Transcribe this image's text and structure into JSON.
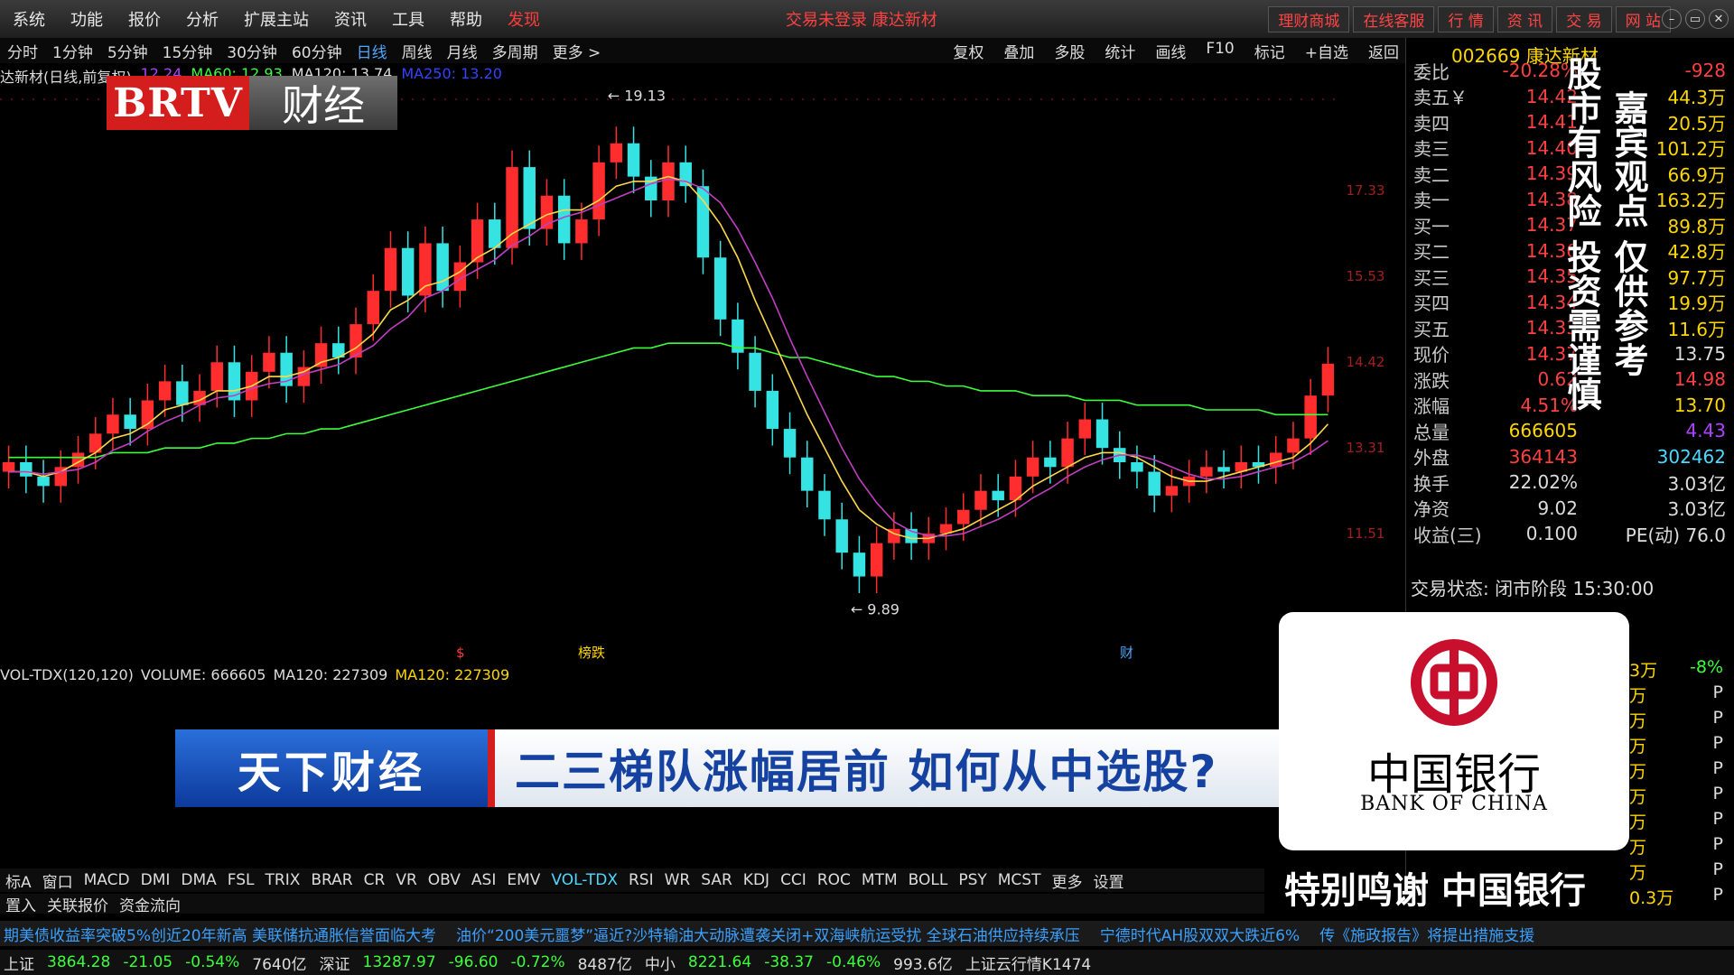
{
  "menu": {
    "items": [
      "系统",
      "功能",
      "报价",
      "分析",
      "扩展主站",
      "资讯",
      "工具",
      "帮助",
      "发现"
    ],
    "center_msg": "交易未登录  康达新材",
    "right_tabs": [
      "理财商城",
      "在线客服",
      "行 情",
      "资 讯",
      "交 易",
      "网 站"
    ]
  },
  "periods": [
    "分时",
    "1分钟",
    "5分钟",
    "15分钟",
    "30分钟",
    "60分钟",
    "日线",
    "周线",
    "月线",
    "多周期",
    "更多 >"
  ],
  "active_period": "日线",
  "tools": [
    "复权",
    "叠加",
    "多股",
    "统计",
    "画线",
    "F10",
    "标记",
    "+自选",
    "返回"
  ],
  "main_header": {
    "title": "达新材(日线,前复权)",
    "ma_a": "12.24",
    "ma60": "MA60: 12.93",
    "ma120": "MA120: 13.74",
    "ma250": "MA250: 13.20"
  },
  "logo": {
    "left": "BRTV",
    "right": "财经"
  },
  "quote": {
    "code": "002669 康达新材",
    "rows": [
      {
        "l": "委比",
        "m": "-20.28%",
        "r": "-928",
        "mc": "#ff4040",
        "rc": "#ff4040"
      },
      {
        "l": "卖五￥",
        "m": "14.42",
        "r": "44.3万",
        "mc": "#ff4040",
        "rc": "#ffd700"
      },
      {
        "l": "卖四",
        "m": "14.41",
        "r": "20.5万",
        "mc": "#ff4040",
        "rc": "#ffd700"
      },
      {
        "l": "卖三",
        "m": "14.40",
        "r": "101.2万",
        "mc": "#ff4040",
        "rc": "#ffd700"
      },
      {
        "l": "卖二",
        "m": "14.39",
        "r": "66.9万",
        "mc": "#ff4040",
        "rc": "#ffd700"
      },
      {
        "l": "卖一",
        "m": "14.38",
        "r": "163.2万",
        "mc": "#ff4040",
        "rc": "#ffd700"
      },
      {
        "l": "买一",
        "m": "14.37",
        "r": "89.8万",
        "mc": "#ff4040",
        "rc": "#ffd700"
      },
      {
        "l": "买二",
        "m": "14.36",
        "r": "42.8万",
        "mc": "#ff4040",
        "rc": "#ffd700"
      },
      {
        "l": "买三",
        "m": "14.35",
        "r": "97.7万",
        "mc": "#ff4040",
        "rc": "#ffd700"
      },
      {
        "l": "买四",
        "m": "14.34",
        "r": "19.9万",
        "mc": "#ff4040",
        "rc": "#ffd700"
      },
      {
        "l": "买五",
        "m": "14.33",
        "r": "11.6万",
        "mc": "#ff4040",
        "rc": "#ffd700"
      },
      {
        "l": "现价",
        "m": "14.37",
        "r": "13.75",
        "mc": "#ff4040",
        "rc": "#ddd"
      },
      {
        "l": "涨跌",
        "m": "0.62",
        "r": "14.98",
        "mc": "#ff4040",
        "rc": "#ff4040"
      },
      {
        "l": "涨幅",
        "m": "4.51%",
        "r": "13.70",
        "mc": "#ff4040",
        "rc": "#ffd700"
      },
      {
        "l": "总量",
        "m": "666605",
        "r": "4.43",
        "mc": "#ffd700",
        "rc": "#b040ff"
      },
      {
        "l": "外盘",
        "m": "364143",
        "r": "302462",
        "mc": "#ff4040",
        "rc": "#4fd8ff"
      },
      {
        "l": "换手",
        "m": "22.02%",
        "r": "3.03亿",
        "mc": "#ddd",
        "rc": "#ddd"
      },
      {
        "l": "净资",
        "m": "9.02",
        "r": "3.03亿",
        "mc": "#ddd",
        "rc": "#ddd"
      },
      {
        "l": "收益(三)",
        "m": "0.100",
        "r": "PE(动)  76.0",
        "mc": "#ddd",
        "rc": "#ddd"
      }
    ],
    "trade_state": "交易状态: 闭市阶段  15:30:00"
  },
  "watermark": {
    "col1": "股市有风险  投资需谨慎",
    "col2": "嘉宾观点  仅供参考"
  },
  "chart_labels": {
    "high": "19.13",
    "low": "9.89",
    "marks": [
      "$",
      "榜跌",
      "财"
    ]
  },
  "vol_header": {
    "title": "VOL-TDX(120,120)",
    "volume": "VOLUME: 666605",
    "ma120": "MA120: 227309",
    "ma120b": "MA120: 227309"
  },
  "banner": {
    "left": "天下财经",
    "right": "二三梯队涨幅居前  如何从中选股?"
  },
  "sponsor": {
    "name": "中国银行",
    "en": "BANK OF CHINA",
    "thanks": "特别鸣谢  中国银行"
  },
  "side_list": [
    {
      "v": "3万",
      "f": "-8%"
    },
    {
      "v": "万",
      "f": "P"
    },
    {
      "v": "万",
      "f": "P"
    },
    {
      "v": "万",
      "f": "P"
    },
    {
      "v": "万",
      "f": "P"
    },
    {
      "v": "万",
      "f": "P"
    },
    {
      "v": "万",
      "f": "P"
    },
    {
      "v": "万",
      "f": "P"
    },
    {
      "v": "万",
      "f": "P"
    },
    {
      "v": "0.3万",
      "f": "P"
    }
  ],
  "indicators": [
    "标A",
    "窗口",
    "MACD",
    "DMI",
    "DMA",
    "FSL",
    "TRIX",
    "BRAR",
    "CR",
    "VR",
    "OBV",
    "ASI",
    "EMV",
    "VOL-TDX",
    "RSI",
    "WR",
    "SAR",
    "KDJ",
    "CCI",
    "ROC",
    "MTM",
    "BOLL",
    "PSY",
    "MCST",
    "更多",
    "设置"
  ],
  "active_indicator": "VOL-TDX",
  "sub_items": [
    "置入",
    "关联报价",
    "资金流向"
  ],
  "ticker": [
    "期美债收益率突破5%创近20年新高  美联储抗通胀信誉面临大考",
    "油价“200美元噩梦”逼近?沙特输油大动脉遭袭关闭+双海峡航运受扰  全球石油供应持续承压",
    "宁德时代AH股双双大跌近6%",
    "传《施政报告》将提出措施支援"
  ],
  "status": [
    {
      "t": "上证",
      "c": "#ddd"
    },
    {
      "t": "3864.28",
      "c": "#3cff3c"
    },
    {
      "t": "-21.05",
      "c": "#3cff3c"
    },
    {
      "t": "-0.54%",
      "c": "#3cff3c"
    },
    {
      "t": "7640亿",
      "c": "#ddd"
    },
    {
      "t": "深证",
      "c": "#ddd"
    },
    {
      "t": "13287.97",
      "c": "#3cff3c"
    },
    {
      "t": "-96.60",
      "c": "#3cff3c"
    },
    {
      "t": "-0.72%",
      "c": "#3cff3c"
    },
    {
      "t": "8487亿",
      "c": "#ddd"
    },
    {
      "t": "中小",
      "c": "#ddd"
    },
    {
      "t": "8221.64",
      "c": "#3cff3c"
    },
    {
      "t": "-38.37",
      "c": "#3cff3c"
    },
    {
      "t": "-0.46%",
      "c": "#3cff3c"
    },
    {
      "t": "993.6亿",
      "c": "#ddd"
    },
    {
      "t": "上证云行情K1474",
      "c": "#ddd"
    }
  ],
  "chart_data": {
    "type": "candlestick",
    "ylim": [
      9,
      20
    ],
    "y_ticks": [
      "17.33",
      "15.53",
      "14.42",
      "13.31",
      "11.51"
    ],
    "closes": [
      12.3,
      12.0,
      11.8,
      12.2,
      12.5,
      12.9,
      13.3,
      13.0,
      13.6,
      14.0,
      13.5,
      13.8,
      14.4,
      13.6,
      14.2,
      14.6,
      13.9,
      14.3,
      14.8,
      14.5,
      15.2,
      15.9,
      16.8,
      15.8,
      16.9,
      15.9,
      16.5,
      17.4,
      16.8,
      18.5,
      17.2,
      17.9,
      16.9,
      17.4,
      18.6,
      19.0,
      18.3,
      17.8,
      18.6,
      18.1,
      16.6,
      15.3,
      14.6,
      13.8,
      13.0,
      12.4,
      11.7,
      11.1,
      10.4,
      9.9,
      10.6,
      10.9,
      10.6,
      10.8,
      11.0,
      11.3,
      11.7,
      11.5,
      12.0,
      12.4,
      12.2,
      12.8,
      13.2,
      12.6,
      12.3,
      12.1,
      11.6,
      11.8,
      12.0,
      12.2,
      12.1,
      12.3,
      12.2,
      12.5,
      12.8,
      13.7,
      14.37
    ],
    "ma_fast": [
      12.1,
      12.1,
      12.0,
      12.1,
      12.3,
      12.5,
      12.8,
      12.9,
      13.1,
      13.4,
      13.5,
      13.6,
      13.8,
      13.8,
      13.9,
      14.1,
      14.1,
      14.2,
      14.4,
      14.5,
      14.7,
      15.0,
      15.5,
      15.7,
      16.0,
      16.1,
      16.3,
      16.6,
      16.8,
      17.1,
      17.3,
      17.5,
      17.6,
      17.6,
      17.8,
      18.1,
      18.2,
      18.2,
      18.3,
      18.2,
      17.8,
      17.3,
      16.6,
      15.7,
      14.9,
      14.1,
      13.3,
      12.6,
      11.9,
      11.3,
      11.0,
      10.8,
      10.7,
      10.7,
      10.8,
      10.9,
      11.1,
      11.3,
      11.5,
      11.8,
      12.0,
      12.2,
      12.4,
      12.5,
      12.5,
      12.4,
      12.2,
      12.0,
      11.9,
      11.9,
      12.0,
      12.1,
      12.2,
      12.3,
      12.4,
      12.7,
      13.1
    ],
    "ma_slow": [
      12.4,
      12.4,
      12.4,
      12.4,
      12.4,
      12.4,
      12.5,
      12.5,
      12.5,
      12.6,
      12.6,
      12.6,
      12.7,
      12.7,
      12.8,
      12.8,
      12.9,
      12.9,
      13.0,
      13.0,
      13.1,
      13.2,
      13.3,
      13.4,
      13.5,
      13.6,
      13.7,
      13.8,
      13.9,
      14.0,
      14.1,
      14.2,
      14.3,
      14.4,
      14.5,
      14.6,
      14.7,
      14.7,
      14.8,
      14.8,
      14.8,
      14.8,
      14.7,
      14.7,
      14.6,
      14.5,
      14.5,
      14.4,
      14.3,
      14.2,
      14.1,
      14.1,
      14.0,
      14.0,
      13.9,
      13.9,
      13.8,
      13.8,
      13.8,
      13.7,
      13.7,
      13.7,
      13.6,
      13.6,
      13.6,
      13.5,
      13.5,
      13.5,
      13.5,
      13.4,
      13.4,
      13.4,
      13.4,
      13.3,
      13.3,
      13.3,
      13.3
    ]
  }
}
